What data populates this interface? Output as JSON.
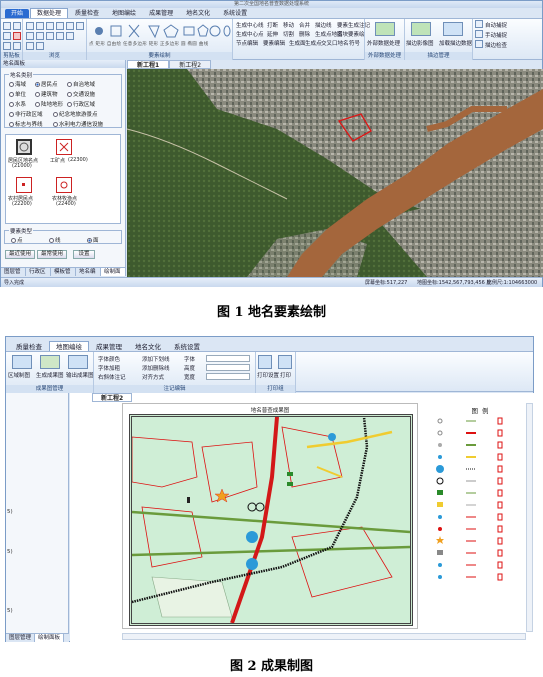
{
  "figure1": {
    "window_title": "第二次全国地名普查数据处理系统",
    "tabs": [
      "开始",
      "数据处理",
      "质量检查",
      "地图编绘",
      "成果管理",
      "地名文化",
      "系统设置"
    ],
    "active_tab_index": 1,
    "ribbon": {
      "groups": [
        "剪贴板",
        "浏览",
        "要素绘制",
        "外部数据处理",
        "描边管理"
      ],
      "draw_buttons": [
        "点",
        "矩形",
        "自由绘",
        "任意多边形",
        "矩形",
        "正多边形",
        "圆",
        "椭圆",
        "曲线"
      ],
      "mid_items": [
        "生成中心线",
        "打断",
        "移动",
        "合并",
        "描边线",
        "要素生成注记",
        "生成中心点",
        "延伸",
        "切割",
        "删除",
        "生成点地名",
        "图块要素绘",
        "节点编辑",
        "要素编辑",
        "生成面",
        "生成点",
        "交叉口地名",
        "符号"
      ],
      "ext_buttons": [
        "外部数据处理",
        "描边影像图",
        "加载描边数据"
      ],
      "right_items": [
        "自动捕捉",
        "手动捕捉",
        "描边检查"
      ]
    },
    "subtabs": [
      "新工程1",
      "新工程2"
    ],
    "left_panel": {
      "header": "地名面板",
      "fieldset1_title": "地名类别",
      "categories": [
        "海域",
        "居民点",
        "自治地域",
        "单位",
        "建筑物",
        "交通设施",
        "水系",
        "陆地地形",
        "行政区域",
        "非行政区域",
        "纪念地旅游景点",
        "标志与界线",
        "水利电力通信设施"
      ],
      "selected_category": "居民点",
      "symbols": [
        {
          "label": "居民区地名点",
          "code": "(21000)"
        },
        {
          "label": "工矿点",
          "code": "(22300)"
        },
        {
          "label": "农村居民点",
          "code": "(22200)"
        },
        {
          "label": "农林牧渔点",
          "code": "(22400)"
        }
      ],
      "fieldset2_title": "要素类型",
      "element_types": [
        "点",
        "线",
        "面"
      ],
      "selected_type": "面",
      "buttons": [
        "最近使用",
        "最常使用",
        "设置"
      ]
    },
    "bottom_tabs": [
      "图层管理",
      "行政区划",
      "模板管理",
      "地名编辑",
      "绘制面板"
    ],
    "status": {
      "left": "导入完成",
      "scale": "屏幕坐标:517,227",
      "coords": "地图坐标:1542,567,793,456 度",
      "ratio": "比例尺:1:104663000"
    },
    "caption": "图 1  地名要素绘制"
  },
  "figure2": {
    "tabs": [
      "质量检查",
      "地图编绘",
      "成果管理",
      "地名文化",
      "系统设置"
    ],
    "active_tab_index": 1,
    "ribbon": {
      "buttons_left": [
        "区域制图",
        "生成成果图",
        "输出成果图"
      ],
      "group1": "成果图管理",
      "font_items": [
        "字体颜色",
        "字体加粗",
        "右斜体注记",
        "添加下划线",
        "添加删除线",
        "对齐方式"
      ],
      "font_labels": [
        "字体",
        "高度",
        "宽度"
      ],
      "group2": "注记编辑",
      "print_buttons": [
        "打印设置",
        "打印"
      ],
      "group3": "打印组"
    },
    "side_numbers": [
      "5)",
      "5)",
      "5)"
    ],
    "subtab": "新工程2",
    "map_title": "地名普查成果图",
    "legend_title": "图例",
    "bottom_tabs": [
      "图层管理",
      "绘制面板"
    ],
    "caption": "图 2  成果制图"
  }
}
